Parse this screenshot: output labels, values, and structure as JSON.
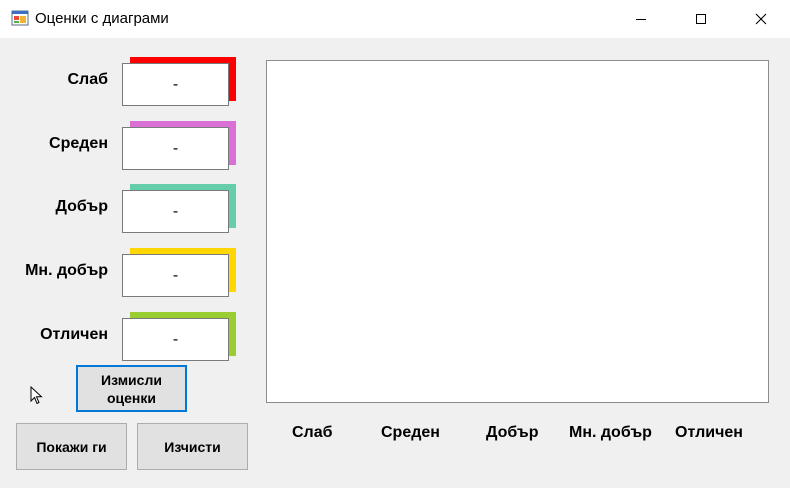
{
  "window": {
    "title": "Оценки с диаграми",
    "icon": "app-window-icon"
  },
  "grades": [
    {
      "label": "Слаб",
      "value": "-",
      "color": "#ff0000"
    },
    {
      "label": "Среден",
      "value": "-",
      "color": "#da70d6"
    },
    {
      "label": "Добър",
      "value": "-",
      "color": "#66cdaa"
    },
    {
      "label": "Мн. добър",
      "value": "-",
      "color": "#ffd700"
    },
    {
      "label": "Отличен",
      "value": "-",
      "color": "#9acd32"
    }
  ],
  "chart_axis_labels": [
    "Слаб",
    "Среден",
    "Добър",
    "Мн. добър",
    "Отличен"
  ],
  "buttons": {
    "generate": "Измисли\nоценки",
    "show": "Покажи ги",
    "clear": "Изчисти"
  },
  "colors": {
    "focus_border": "#0078d7",
    "client_background": "#f0f0f0"
  }
}
